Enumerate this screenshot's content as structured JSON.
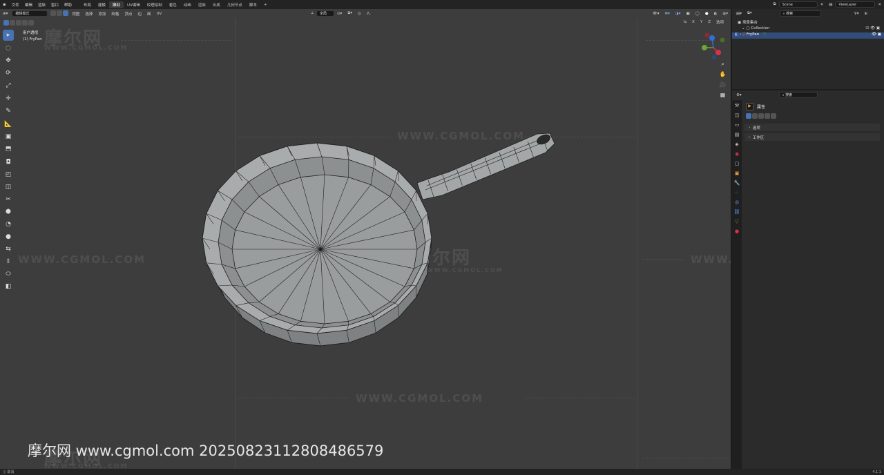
{
  "app": {
    "menus": [
      "文件",
      "编辑",
      "渲染",
      "窗口",
      "帮助"
    ],
    "workspaces": [
      "布局",
      "建模",
      "雕刻",
      "UV编辑",
      "纹理绘制",
      "着色",
      "动画",
      "渲染",
      "合成",
      "几何节点",
      "脚本",
      "+"
    ],
    "active_workspace_index": 2,
    "scene_name": "Scene",
    "view_layer": "ViewLayer"
  },
  "viewport_header": {
    "mode": "编辑模式",
    "menus": [
      "视图",
      "选择",
      "添加",
      "网格",
      "顶点",
      "边",
      "面",
      "UV"
    ],
    "transform_orientation": "全局",
    "options_label": "选项",
    "axes": [
      "X",
      "Y",
      "Z"
    ]
  },
  "viewport_overlay": {
    "view_name": "用户透视",
    "object_label": "(1) FryPan"
  },
  "toolbar": {
    "tools": [
      "select-box",
      "cursor",
      "move",
      "rotate",
      "scale",
      "transform",
      "annotate",
      "measure",
      "add-cube",
      "extrude",
      "inset",
      "bevel",
      "loop-cut",
      "knife",
      "poly-build",
      "spin",
      "smooth",
      "edge-slide",
      "shrink-fatten",
      "shear",
      "rip"
    ],
    "tool_glyphs": [
      "▸",
      "◌",
      "✥",
      "⟳",
      "⤢",
      "✛",
      "✎",
      "📐",
      "▣",
      "⬒",
      "◘",
      "◰",
      "◫",
      "✂",
      "⬢",
      "◔",
      "●",
      "⇆",
      "⇳",
      "⬭",
      "◧"
    ]
  },
  "outliner": {
    "search_placeholder": "搜索",
    "root": "场景集合",
    "collection": "Collection",
    "object": "FryPan"
  },
  "properties": {
    "search_placeholder": "搜索",
    "title": "属性",
    "panels": [
      "选项",
      "工作区"
    ]
  },
  "statusbar": {
    "left": "取消",
    "right": "4.1.1"
  },
  "watermark": {
    "brand": "摩尔网",
    "url": "WWW.CGMOL.COM",
    "caption": "摩尔网 www.cgmol.com 20250823112808486579"
  },
  "colors": {
    "accent": "#4772b3",
    "viewport_bg": "#3d3d3d",
    "mesh_face": "#9a9d9e",
    "mesh_wire": "#1e1e1e"
  }
}
